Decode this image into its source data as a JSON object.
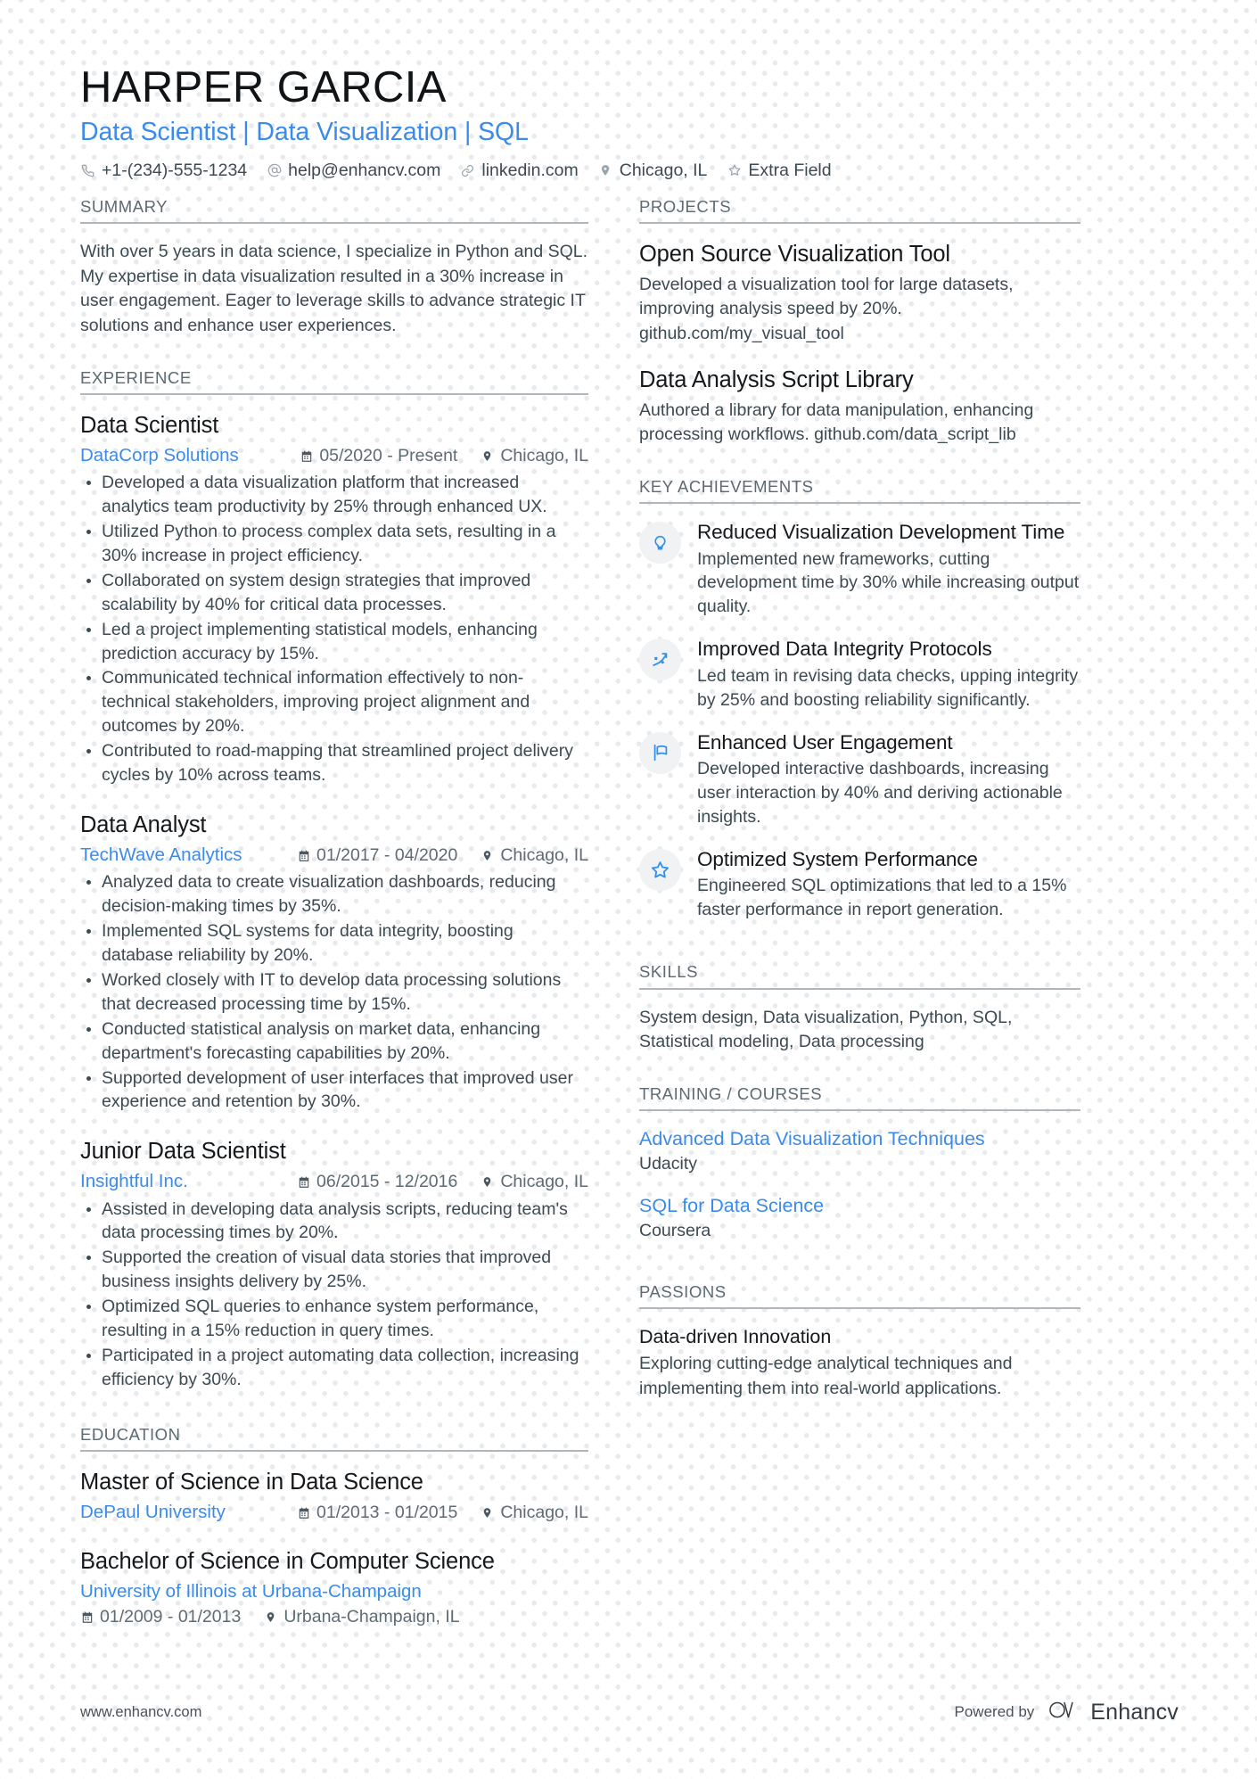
{
  "header": {
    "name": "HARPER GARCIA",
    "role": "Data Scientist | Data Visualization | SQL",
    "contacts": [
      {
        "icon": "phone-icon",
        "text": "+1-(234)-555-1234"
      },
      {
        "icon": "email-icon",
        "text": "help@enhancv.com"
      },
      {
        "icon": "link-icon",
        "text": "linkedin.com"
      },
      {
        "icon": "location-pin-icon",
        "text": "Chicago, IL"
      },
      {
        "icon": "star-icon",
        "text": "Extra Field"
      }
    ]
  },
  "left": {
    "summary": {
      "title": "SUMMARY",
      "text": "With over 5 years in data science, I specialize in Python and SQL. My expertise in data visualization resulted in a 30% increase in user engagement. Eager to leverage skills to advance strategic IT solutions and enhance user experiences."
    },
    "experience": {
      "title": "EXPERIENCE",
      "entries": [
        {
          "role": "Data Scientist",
          "company": "DataCorp Solutions",
          "dates": "05/2020 - Present",
          "location": "Chicago, IL",
          "bullets": [
            "Developed a data visualization platform that increased analytics team productivity by 25% through enhanced UX.",
            "Utilized Python to process complex data sets, resulting in a 30% increase in project efficiency.",
            "Collaborated on system design strategies that improved scalability by 40% for critical data processes.",
            "Led a project implementing statistical models, enhancing prediction accuracy by 15%.",
            "Communicated technical information effectively to non-technical stakeholders, improving project alignment and outcomes by 20%.",
            "Contributed to road-mapping that streamlined project delivery cycles by 10% across teams."
          ]
        },
        {
          "role": "Data Analyst",
          "company": "TechWave Analytics",
          "dates": "01/2017 - 04/2020",
          "location": "Chicago, IL",
          "bullets": [
            "Analyzed data to create visualization dashboards, reducing decision-making times by 35%.",
            "Implemented SQL systems for data integrity, boosting database reliability by 20%.",
            "Worked closely with IT to develop data processing solutions that decreased processing time by 15%.",
            "Conducted statistical analysis on market data, enhancing department's forecasting capabilities by 20%.",
            "Supported development of user interfaces that improved user experience and retention by 30%."
          ]
        },
        {
          "role": "Junior Data Scientist",
          "company": "Insightful Inc.",
          "dates": "06/2015 - 12/2016",
          "location": "Chicago, IL",
          "bullets": [
            "Assisted in developing data analysis scripts, reducing team's data processing times by 20%.",
            "Supported the creation of visual data stories that improved business insights delivery by 25%.",
            "Optimized SQL queries to enhance system performance, resulting in a 15% reduction in query times.",
            "Participated in a project automating data collection, increasing efficiency by 30%."
          ]
        }
      ]
    },
    "education": {
      "title": "EDUCATION",
      "entries": [
        {
          "degree": "Master of Science in Data Science",
          "school": "DePaul University",
          "dates": "01/2013 - 01/2015",
          "location": "Chicago, IL",
          "stacked": false
        },
        {
          "degree": "Bachelor of Science in Computer Science",
          "school": "University of Illinois at Urbana-Champaign",
          "dates": "01/2009 - 01/2013",
          "location": "Urbana-Champaign, IL",
          "stacked": true
        }
      ]
    }
  },
  "right": {
    "projects": {
      "title": "PROJECTS",
      "items": [
        {
          "name": "Open Source Visualization Tool",
          "description": "Developed a visualization tool for large datasets, improving analysis speed by 20%. github.com/my_visual_tool"
        },
        {
          "name": "Data Analysis Script Library",
          "description": "Authored a library for data manipulation, enhancing processing workflows. github.com/data_script_lib"
        }
      ]
    },
    "achievements": {
      "title": "KEY ACHIEVEMENTS",
      "items": [
        {
          "icon": "lightbulb-icon",
          "title": "Reduced Visualization Development Time",
          "description": "Implemented new frameworks, cutting development time by 30% while increasing output quality."
        },
        {
          "icon": "trend-arrow-icon",
          "title": "Improved Data Integrity Protocols",
          "description": "Led team in revising data checks, upping integrity by 25% and boosting reliability significantly."
        },
        {
          "icon": "flag-icon",
          "title": "Enhanced User Engagement",
          "description": "Developed interactive dashboards, increasing user interaction by 40% and deriving actionable insights."
        },
        {
          "icon": "star-outline-icon",
          "title": "Optimized System Performance",
          "description": "Engineered SQL optimizations that led to a 15% faster performance in report generation."
        }
      ]
    },
    "skills": {
      "title": "SKILLS",
      "text": "System design, Data visualization, Python, SQL, Statistical modeling, Data processing"
    },
    "training": {
      "title": "TRAINING / COURSES",
      "items": [
        {
          "name": "Advanced Data Visualization Techniques",
          "provider": "Udacity"
        },
        {
          "name": "SQL for Data Science",
          "provider": "Coursera"
        }
      ]
    },
    "passions": {
      "title": "PASSIONS",
      "items": [
        {
          "name": "Data-driven Innovation",
          "description": "Exploring cutting-edge analytical techniques and implementing them into real-world applications."
        }
      ]
    }
  },
  "footer": {
    "url": "www.enhancv.com",
    "powered_by": "Powered by",
    "brand": "Enhancv"
  },
  "colors": {
    "accent": "#3b8beb",
    "text": "#3c4a52",
    "heading": "#15191c",
    "section_label": "#5c6a72",
    "rule": "#b0b6ba",
    "badge_bg": "#f1f2f3",
    "dot_pattern": "#e8eaec"
  }
}
